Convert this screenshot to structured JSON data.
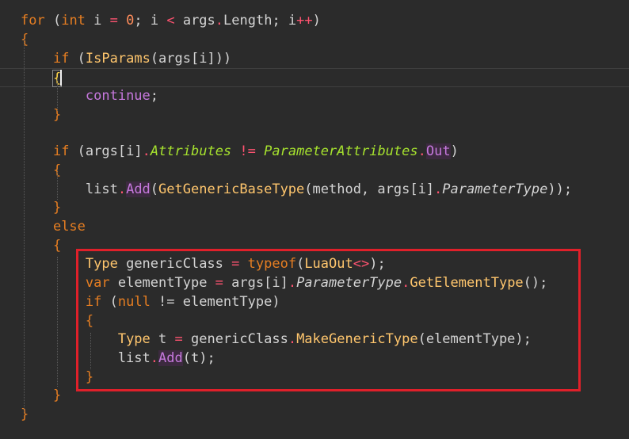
{
  "editor": {
    "theme_colors": {
      "background": "#2b2b2b",
      "keyword": "#e67e22",
      "keyword_alt": "#c678dd",
      "function": "#ffc66d",
      "attribute": "#a6e22e",
      "operator": "#ff5370",
      "text": "#d4d4d4",
      "annotation_box": "#e0202a"
    },
    "lines": [
      {
        "tokens": [
          {
            "t": "for",
            "c": "kw"
          },
          {
            "t": " (",
            "c": "pn"
          },
          {
            "t": "int",
            "c": "kw"
          },
          {
            "t": " i ",
            "c": "id"
          },
          {
            "t": "=",
            "c": "op"
          },
          {
            "t": " ",
            "c": "pn"
          },
          {
            "t": "0",
            "c": "num"
          },
          {
            "t": "; i ",
            "c": "id"
          },
          {
            "t": "<",
            "c": "op"
          },
          {
            "t": " args",
            "c": "id"
          },
          {
            "t": ".",
            "c": "op"
          },
          {
            "t": "Length; i",
            "c": "id"
          },
          {
            "t": "++",
            "c": "op"
          },
          {
            "t": ")",
            "c": "pn"
          }
        ]
      },
      {
        "tokens": [
          {
            "t": "{",
            "c": "kw"
          }
        ]
      },
      {
        "tokens": [
          {
            "t": "    ",
            "c": "pn"
          },
          {
            "t": "if",
            "c": "kw"
          },
          {
            "t": " (",
            "c": "pn"
          },
          {
            "t": "IsParams",
            "c": "fn"
          },
          {
            "t": "(args[i]))",
            "c": "pn"
          }
        ]
      },
      {
        "tokens": [
          {
            "t": "    ",
            "c": "pn"
          },
          {
            "t": "{",
            "c": "br"
          }
        ],
        "current": true
      },
      {
        "tokens": [
          {
            "t": "        ",
            "c": "pn"
          },
          {
            "t": "continue",
            "c": "kw2"
          },
          {
            "t": ";",
            "c": "pn"
          }
        ]
      },
      {
        "tokens": [
          {
            "t": "    ",
            "c": "pn"
          },
          {
            "t": "}",
            "c": "kw"
          }
        ]
      },
      {
        "tokens": []
      },
      {
        "tokens": [
          {
            "t": "    ",
            "c": "pn"
          },
          {
            "t": "if",
            "c": "kw"
          },
          {
            "t": " (args[i]",
            "c": "pn"
          },
          {
            "t": ".",
            "c": "op"
          },
          {
            "t": "Attributes",
            "c": "attr"
          },
          {
            "t": " ",
            "c": "pn"
          },
          {
            "t": "!=",
            "c": "op"
          },
          {
            "t": " ",
            "c": "pn"
          },
          {
            "t": "ParameterAttributes",
            "c": "attr"
          },
          {
            "t": ".",
            "c": "op"
          },
          {
            "t": "Out",
            "c": "kw2hl"
          },
          {
            "t": ")",
            "c": "pn"
          }
        ]
      },
      {
        "tokens": [
          {
            "t": "    ",
            "c": "pn"
          },
          {
            "t": "{",
            "c": "kw"
          }
        ]
      },
      {
        "tokens": [
          {
            "t": "        list",
            "c": "id"
          },
          {
            "t": ".",
            "c": "op"
          },
          {
            "t": "Add",
            "c": "kw2hl"
          },
          {
            "t": "(",
            "c": "pn"
          },
          {
            "t": "GetGenericBaseType",
            "c": "fn"
          },
          {
            "t": "(method, args[i]",
            "c": "pn"
          },
          {
            "t": ".",
            "c": "op"
          },
          {
            "t": "ParameterType",
            "c": "prop"
          },
          {
            "t": "));",
            "c": "pn"
          }
        ]
      },
      {
        "tokens": [
          {
            "t": "    ",
            "c": "pn"
          },
          {
            "t": "}",
            "c": "kw"
          }
        ]
      },
      {
        "tokens": [
          {
            "t": "    ",
            "c": "pn"
          },
          {
            "t": "else",
            "c": "kw"
          }
        ]
      },
      {
        "tokens": [
          {
            "t": "    ",
            "c": "pn"
          },
          {
            "t": "{",
            "c": "kw"
          }
        ]
      },
      {
        "tokens": [
          {
            "t": "        ",
            "c": "pn"
          },
          {
            "t": "Type",
            "c": "fn"
          },
          {
            "t": " genericClass ",
            "c": "id"
          },
          {
            "t": "=",
            "c": "op"
          },
          {
            "t": " ",
            "c": "pn"
          },
          {
            "t": "typeof",
            "c": "kw"
          },
          {
            "t": "(",
            "c": "pn"
          },
          {
            "t": "LuaOut",
            "c": "fn"
          },
          {
            "t": "<>",
            "c": "op"
          },
          {
            "t": ");",
            "c": "pn"
          }
        ]
      },
      {
        "tokens": [
          {
            "t": "        ",
            "c": "pn"
          },
          {
            "t": "var",
            "c": "kw"
          },
          {
            "t": " elementType ",
            "c": "id"
          },
          {
            "t": "=",
            "c": "op"
          },
          {
            "t": " args[i]",
            "c": "id"
          },
          {
            "t": ".",
            "c": "op"
          },
          {
            "t": "ParameterType",
            "c": "prop"
          },
          {
            "t": ".",
            "c": "op"
          },
          {
            "t": "GetElementType",
            "c": "fn"
          },
          {
            "t": "();",
            "c": "pn"
          }
        ]
      },
      {
        "tokens": [
          {
            "t": "        ",
            "c": "pn"
          },
          {
            "t": "if",
            "c": "kw"
          },
          {
            "t": " (",
            "c": "pn"
          },
          {
            "t": "null",
            "c": "kw"
          },
          {
            "t": " != elementType)",
            "c": "id"
          }
        ]
      },
      {
        "tokens": [
          {
            "t": "        ",
            "c": "pn"
          },
          {
            "t": "{",
            "c": "kw"
          }
        ]
      },
      {
        "tokens": [
          {
            "t": "            ",
            "c": "pn"
          },
          {
            "t": "Type",
            "c": "fn"
          },
          {
            "t": " t ",
            "c": "id"
          },
          {
            "t": "=",
            "c": "op"
          },
          {
            "t": " genericClass",
            "c": "id"
          },
          {
            "t": ".",
            "c": "op"
          },
          {
            "t": "MakeGenericType",
            "c": "fn"
          },
          {
            "t": "(elementType);",
            "c": "pn"
          }
        ]
      },
      {
        "tokens": [
          {
            "t": "            list",
            "c": "id"
          },
          {
            "t": ".",
            "c": "op"
          },
          {
            "t": "Add",
            "c": "kw2hl"
          },
          {
            "t": "(t);",
            "c": "pn"
          }
        ]
      },
      {
        "tokens": [
          {
            "t": "        ",
            "c": "pn"
          },
          {
            "t": "}",
            "c": "kw"
          }
        ]
      },
      {
        "tokens": [
          {
            "t": "    ",
            "c": "pn"
          },
          {
            "t": "}",
            "c": "kw"
          }
        ]
      },
      {
        "tokens": [
          {
            "t": "}",
            "c": "kw"
          }
        ]
      }
    ]
  }
}
